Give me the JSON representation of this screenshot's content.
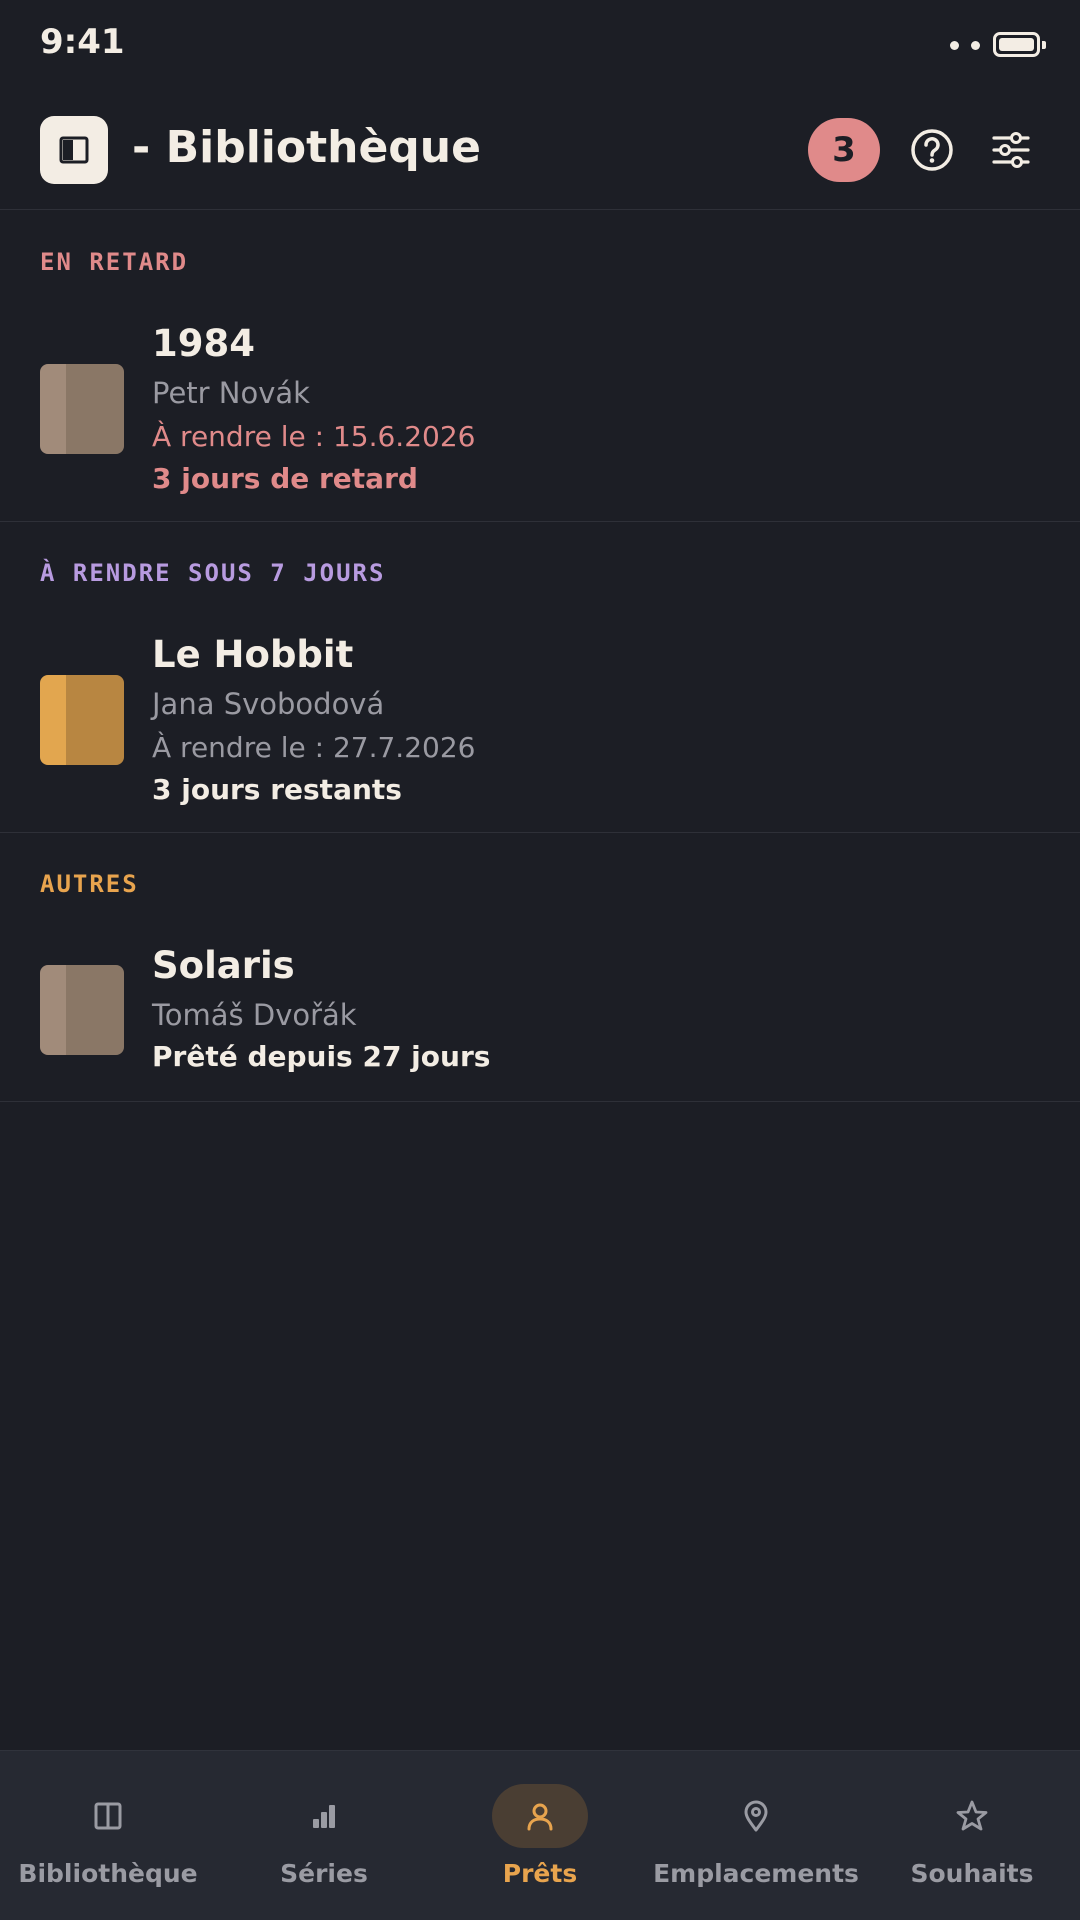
{
  "status_bar": {
    "time": "9:41"
  },
  "header": {
    "title": "- Bibliothèque",
    "badge_count": "3",
    "icons": [
      "book-icon",
      "help-icon",
      "sliders-icon"
    ]
  },
  "sections": [
    {
      "label": "EN RETARD",
      "color": "#e08a8a",
      "items": [
        {
          "title": "1984",
          "author": "Petr Novák",
          "due": "À rendre le : 15.6.2026",
          "status": "3 jours de retard",
          "due_color": "#e08a8a",
          "status_color": "#e08a8a",
          "cover_spine": "#a18b7a",
          "cover_face": "#8a7766"
        }
      ]
    },
    {
      "label": "À RENDRE SOUS 7 JOURS",
      "color": "#b89be0",
      "items": [
        {
          "title": "Le Hobbit",
          "author": "Jana Svobodová",
          "due": "À rendre le : 27.7.2026",
          "status": "3 jours restants",
          "due_color": "#9a9aa2",
          "status_color": "#f3ede4",
          "cover_spine": "#e2a64f",
          "cover_face": "#b88641"
        }
      ]
    },
    {
      "label": "AUTRES",
      "color": "#e8a44e",
      "items": [
        {
          "title": "Solaris",
          "author": "Tomáš Dvořák",
          "status": "Prêté depuis 27 jours",
          "status_color": "#f3ede4",
          "cover_spine": "#a18b7a",
          "cover_face": "#8a7766"
        }
      ]
    }
  ],
  "bottom_nav": [
    {
      "label": "Bibliothèque",
      "icon": "book-icon",
      "active": false
    },
    {
      "label": "Séries",
      "icon": "bar-chart-icon",
      "active": false
    },
    {
      "label": "Prêts",
      "icon": "person-icon",
      "active": true
    },
    {
      "label": "Emplacements",
      "icon": "location-pin-icon",
      "active": false
    },
    {
      "label": "Souhaits",
      "icon": "star-icon",
      "active": false
    }
  ],
  "colors": {
    "background": "#1c1e25",
    "accent": "#e8a44e",
    "overdue": "#e08a8a",
    "soon": "#b89be0"
  }
}
